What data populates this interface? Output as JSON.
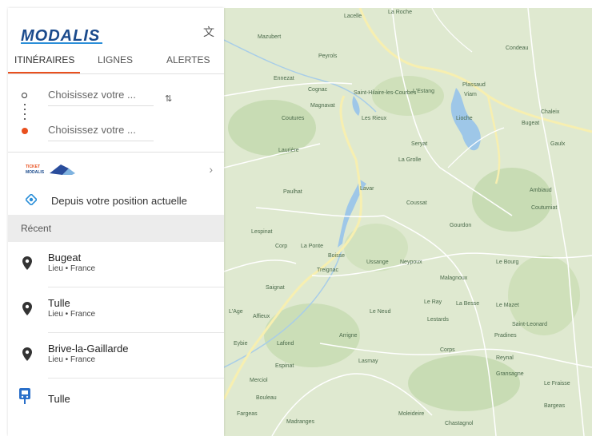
{
  "brand": {
    "logo_text": "MODALIS"
  },
  "header": {
    "translate_icon": "translate-icon"
  },
  "tabs": [
    {
      "label": "ITINÉRAIRES",
      "active": true
    },
    {
      "label": "LIGNES",
      "active": false
    },
    {
      "label": "ALERTES",
      "active": false
    }
  ],
  "search": {
    "origin_placeholder": "Choisissez votre ...",
    "destination_placeholder": "Choisissez votre ...",
    "swap_icon": "swap-vertical-icon"
  },
  "ticket": {
    "logo_text": "TICKET MODALIS",
    "chevron_icon": "chevron-right-icon"
  },
  "current_position": {
    "label": "Depuis votre position actuelle",
    "icon": "my-location-icon"
  },
  "recent": {
    "header": "Récent",
    "items": [
      {
        "name": "Bugeat",
        "sub": "Lieu • France",
        "icon": "pin-icon"
      },
      {
        "name": "Tulle",
        "sub": "Lieu • France",
        "icon": "pin-icon"
      },
      {
        "name": "Brive-la-Gaillarde",
        "sub": "Lieu • France",
        "icon": "pin-icon"
      },
      {
        "name": "Tulle",
        "sub": "",
        "icon": "tram-stop-icon"
      }
    ]
  },
  "colors": {
    "accent": "#e9501e",
    "brand_blue": "#1a4a8c",
    "map_land": "#dde8cf",
    "water": "#9ec7e8",
    "road": "#f7efb0"
  },
  "map": {
    "labels": [
      "Lacelle",
      "La Roche",
      "Mazubert",
      "Peyrols",
      "Condeau",
      "Ennezat",
      "Cognac",
      "Saint-Hilaire-les-Courbes",
      "L'Estang",
      "Viam",
      "Plassaud",
      "Magnavat",
      "Coutures",
      "Les Rieux",
      "Lioche",
      "Bugeat",
      "Chaleix",
      "Laurière",
      "Seryat",
      "La Grolle",
      "Gaulx",
      "Lavar",
      "Paulhat",
      "Coussat",
      "Ambiaud",
      "Couturniat",
      "Lespinat",
      "Corp",
      "La Ponte",
      "Boisse",
      "Treignac",
      "Gourdon",
      "Ussange",
      "Neypoux",
      "Le Bourg",
      "Saignat",
      "Malagnoux",
      "Le Mazet",
      "L'Age",
      "Affieux",
      "Le Neud",
      "Le Ray",
      "La Besse",
      "Lestards",
      "Saint-Leonard",
      "Eybie",
      "Lafond",
      "Arrigne",
      "Corps",
      "Pradines",
      "Espinat",
      "Lasmay",
      "Reynal",
      "Gransagne",
      "Merciol",
      "Bouleau",
      "Fargeas",
      "Madranges",
      "Moleideire",
      "Chastagnol",
      "Le Fraisse",
      "Bargeas"
    ]
  }
}
